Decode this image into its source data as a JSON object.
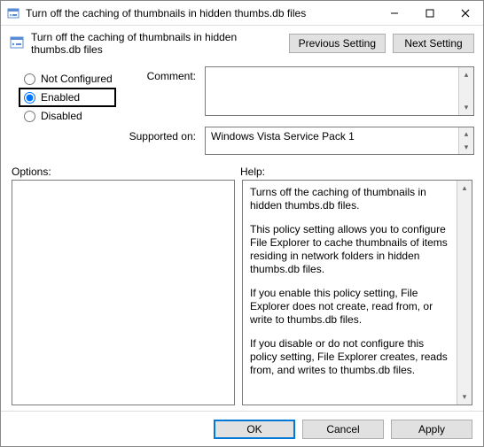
{
  "titlebar": {
    "title": "Turn off the caching of thumbnails in hidden thumbs.db files"
  },
  "header": {
    "text": "Turn off the caching of thumbnails in hidden thumbs.db files",
    "prev": "Previous Setting",
    "next": "Next Setting"
  },
  "config": {
    "not_configured": "Not Configured",
    "enabled": "Enabled",
    "disabled": "Disabled",
    "comment_label": "Comment:",
    "supported_label": "Supported on:",
    "supported_value": "Windows Vista Service Pack 1"
  },
  "labels": {
    "options": "Options:",
    "help": "Help:"
  },
  "help": {
    "p1": "Turns off the caching of thumbnails in hidden thumbs.db files.",
    "p2": "This policy setting allows you to configure File Explorer to cache thumbnails of items residing in network folders in hidden thumbs.db files.",
    "p3": "If you enable this policy setting, File Explorer does not create, read from, or write to thumbs.db files.",
    "p4": "If you disable or do not configure this policy setting, File Explorer creates, reads from, and writes to thumbs.db files."
  },
  "footer": {
    "ok": "OK",
    "cancel": "Cancel",
    "apply": "Apply"
  }
}
